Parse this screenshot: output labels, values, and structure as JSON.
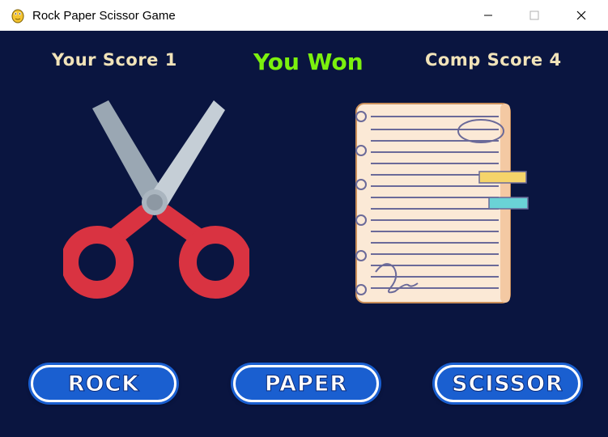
{
  "window": {
    "title": "Rock Paper Scissor Game",
    "icon": "pygame-snake-icon"
  },
  "scores": {
    "player": "Your Score 1",
    "computer": "Comp Score 4"
  },
  "result": "You Won",
  "player_choice": "scissors-image",
  "computer_choice": "paper-notebook-image",
  "buttons": {
    "rock": "ROCK",
    "paper": "PAPER",
    "scissor": "SCISSOR"
  },
  "colors": {
    "background": "#0a1540",
    "score_text": "#f1e3b9",
    "result_text": "#7cf00e",
    "button": "#1a5fd0"
  }
}
